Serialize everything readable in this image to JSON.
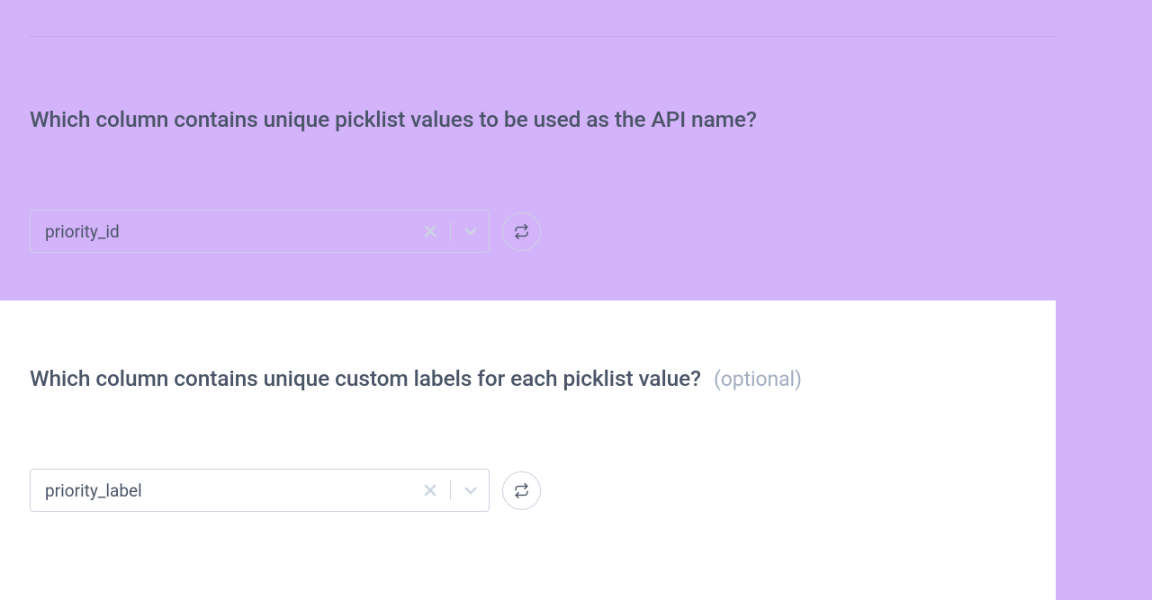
{
  "section1": {
    "question": "Which column contains unique picklist values to be used as the API name?",
    "select_value": "priority_id"
  },
  "section2": {
    "question": "Which column contains unique custom labels for each picklist value?",
    "optional_label": "(optional)",
    "select_value": "priority_label"
  }
}
